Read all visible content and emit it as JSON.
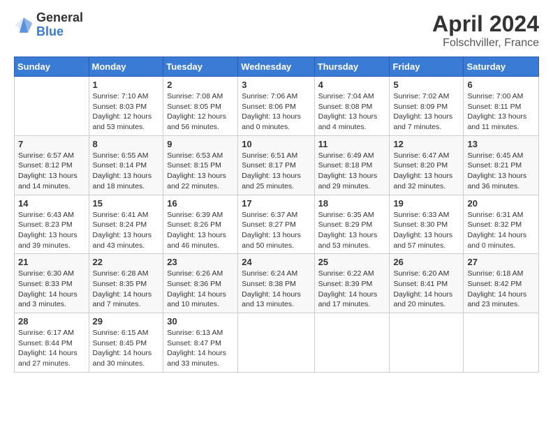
{
  "header": {
    "logo_general": "General",
    "logo_blue": "Blue",
    "title": "April 2024",
    "location": "Folschviller, France"
  },
  "days_of_week": [
    "Sunday",
    "Monday",
    "Tuesday",
    "Wednesday",
    "Thursday",
    "Friday",
    "Saturday"
  ],
  "weeks": [
    [
      {
        "day": "",
        "info": ""
      },
      {
        "day": "1",
        "info": "Sunrise: 7:10 AM\nSunset: 8:03 PM\nDaylight: 12 hours\nand 53 minutes."
      },
      {
        "day": "2",
        "info": "Sunrise: 7:08 AM\nSunset: 8:05 PM\nDaylight: 12 hours\nand 56 minutes."
      },
      {
        "day": "3",
        "info": "Sunrise: 7:06 AM\nSunset: 8:06 PM\nDaylight: 13 hours\nand 0 minutes."
      },
      {
        "day": "4",
        "info": "Sunrise: 7:04 AM\nSunset: 8:08 PM\nDaylight: 13 hours\nand 4 minutes."
      },
      {
        "day": "5",
        "info": "Sunrise: 7:02 AM\nSunset: 8:09 PM\nDaylight: 13 hours\nand 7 minutes."
      },
      {
        "day": "6",
        "info": "Sunrise: 7:00 AM\nSunset: 8:11 PM\nDaylight: 13 hours\nand 11 minutes."
      }
    ],
    [
      {
        "day": "7",
        "info": "Sunrise: 6:57 AM\nSunset: 8:12 PM\nDaylight: 13 hours\nand 14 minutes."
      },
      {
        "day": "8",
        "info": "Sunrise: 6:55 AM\nSunset: 8:14 PM\nDaylight: 13 hours\nand 18 minutes."
      },
      {
        "day": "9",
        "info": "Sunrise: 6:53 AM\nSunset: 8:15 PM\nDaylight: 13 hours\nand 22 minutes."
      },
      {
        "day": "10",
        "info": "Sunrise: 6:51 AM\nSunset: 8:17 PM\nDaylight: 13 hours\nand 25 minutes."
      },
      {
        "day": "11",
        "info": "Sunrise: 6:49 AM\nSunset: 8:18 PM\nDaylight: 13 hours\nand 29 minutes."
      },
      {
        "day": "12",
        "info": "Sunrise: 6:47 AM\nSunset: 8:20 PM\nDaylight: 13 hours\nand 32 minutes."
      },
      {
        "day": "13",
        "info": "Sunrise: 6:45 AM\nSunset: 8:21 PM\nDaylight: 13 hours\nand 36 minutes."
      }
    ],
    [
      {
        "day": "14",
        "info": "Sunrise: 6:43 AM\nSunset: 8:23 PM\nDaylight: 13 hours\nand 39 minutes."
      },
      {
        "day": "15",
        "info": "Sunrise: 6:41 AM\nSunset: 8:24 PM\nDaylight: 13 hours\nand 43 minutes."
      },
      {
        "day": "16",
        "info": "Sunrise: 6:39 AM\nSunset: 8:26 PM\nDaylight: 13 hours\nand 46 minutes."
      },
      {
        "day": "17",
        "info": "Sunrise: 6:37 AM\nSunset: 8:27 PM\nDaylight: 13 hours\nand 50 minutes."
      },
      {
        "day": "18",
        "info": "Sunrise: 6:35 AM\nSunset: 8:29 PM\nDaylight: 13 hours\nand 53 minutes."
      },
      {
        "day": "19",
        "info": "Sunrise: 6:33 AM\nSunset: 8:30 PM\nDaylight: 13 hours\nand 57 minutes."
      },
      {
        "day": "20",
        "info": "Sunrise: 6:31 AM\nSunset: 8:32 PM\nDaylight: 14 hours\nand 0 minutes."
      }
    ],
    [
      {
        "day": "21",
        "info": "Sunrise: 6:30 AM\nSunset: 8:33 PM\nDaylight: 14 hours\nand 3 minutes."
      },
      {
        "day": "22",
        "info": "Sunrise: 6:28 AM\nSunset: 8:35 PM\nDaylight: 14 hours\nand 7 minutes."
      },
      {
        "day": "23",
        "info": "Sunrise: 6:26 AM\nSunset: 8:36 PM\nDaylight: 14 hours\nand 10 minutes."
      },
      {
        "day": "24",
        "info": "Sunrise: 6:24 AM\nSunset: 8:38 PM\nDaylight: 14 hours\nand 13 minutes."
      },
      {
        "day": "25",
        "info": "Sunrise: 6:22 AM\nSunset: 8:39 PM\nDaylight: 14 hours\nand 17 minutes."
      },
      {
        "day": "26",
        "info": "Sunrise: 6:20 AM\nSunset: 8:41 PM\nDaylight: 14 hours\nand 20 minutes."
      },
      {
        "day": "27",
        "info": "Sunrise: 6:18 AM\nSunset: 8:42 PM\nDaylight: 14 hours\nand 23 minutes."
      }
    ],
    [
      {
        "day": "28",
        "info": "Sunrise: 6:17 AM\nSunset: 8:44 PM\nDaylight: 14 hours\nand 27 minutes."
      },
      {
        "day": "29",
        "info": "Sunrise: 6:15 AM\nSunset: 8:45 PM\nDaylight: 14 hours\nand 30 minutes."
      },
      {
        "day": "30",
        "info": "Sunrise: 6:13 AM\nSunset: 8:47 PM\nDaylight: 14 hours\nand 33 minutes."
      },
      {
        "day": "",
        "info": ""
      },
      {
        "day": "",
        "info": ""
      },
      {
        "day": "",
        "info": ""
      },
      {
        "day": "",
        "info": ""
      }
    ]
  ]
}
